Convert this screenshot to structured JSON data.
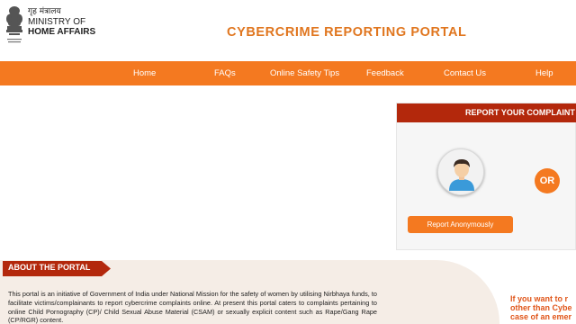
{
  "header": {
    "ministry_hindi": "गृह मंत्रालय",
    "ministry_line1": "MINISTRY OF",
    "ministry_line2": "HOME AFFAIRS",
    "emblem_icon": "national-emblem-icon",
    "portal_title": "CYBERCRIME REPORTING PORTAL"
  },
  "nav": {
    "items": [
      {
        "label": "Home"
      },
      {
        "label": "FAQs"
      },
      {
        "label": "Online Safety Tips"
      },
      {
        "label": "Feedback"
      },
      {
        "label": "Contact Us"
      },
      {
        "label": "Help"
      }
    ]
  },
  "report": {
    "header": "REPORT YOUR COMPLAINT",
    "avatar_icon": "user-avatar-icon",
    "or_label": "OR",
    "anonymous_button": "Report Anonymously"
  },
  "about": {
    "title": "ABOUT THE PORTAL",
    "text": "This portal is an initiative of Government of India under National Mission for the safety of women by utilising Nirbhaya funds, to facilitate victims/complainants to report cybercrime complaints online. At present this portal caters to complaints pertaining to online Child Pornography (CP)/ Child Sexual Abuse Material (CSAM) or sexually explicit content such as Rape/Gang Rape (CP/RGR) content."
  },
  "side_note": {
    "line1": "If you want to r",
    "line2": "other than Cybe",
    "line3": "case of an emer"
  },
  "colors": {
    "accent_orange": "#f47920",
    "title_orange": "#e0761f",
    "dark_red": "#b3280c",
    "about_bg": "#f5ede6"
  }
}
